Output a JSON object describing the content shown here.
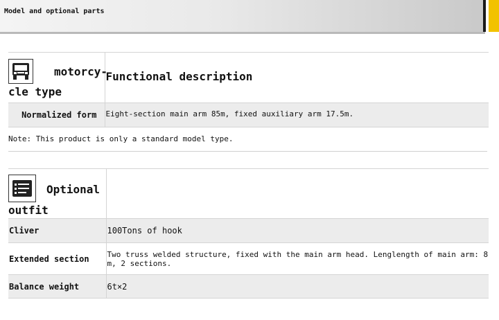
{
  "header": {
    "title": "Model and optional parts"
  },
  "model_table": {
    "type_label_line1": "motorcy-",
    "type_label_line2": "cle type",
    "column_header": "Functional description",
    "row_label": "Normalized form",
    "row_value": "Eight-section main arm 85m, fixed auxiliary arm 17.5m."
  },
  "note": "Note: This product is only a standard model type.",
  "optional_table": {
    "header_label_line1": "Optional",
    "header_label_line2": "outfit",
    "rows": [
      {
        "label": "Cliver",
        "value": "100Tons of hook"
      },
      {
        "label": "Extended section",
        "value_line1": "Two truss welded structure, fixed with the main arm head. Lenglength of main arm: 8",
        "value_line2": "m, 2 sections."
      },
      {
        "label": "Balance weight",
        "value": "6t×2"
      }
    ]
  },
  "icons": {
    "vehicle": "truck-front-icon",
    "optional": "document-list-icon"
  },
  "colors": {
    "accent": "#f2c200",
    "row_grey": "#ececec"
  }
}
